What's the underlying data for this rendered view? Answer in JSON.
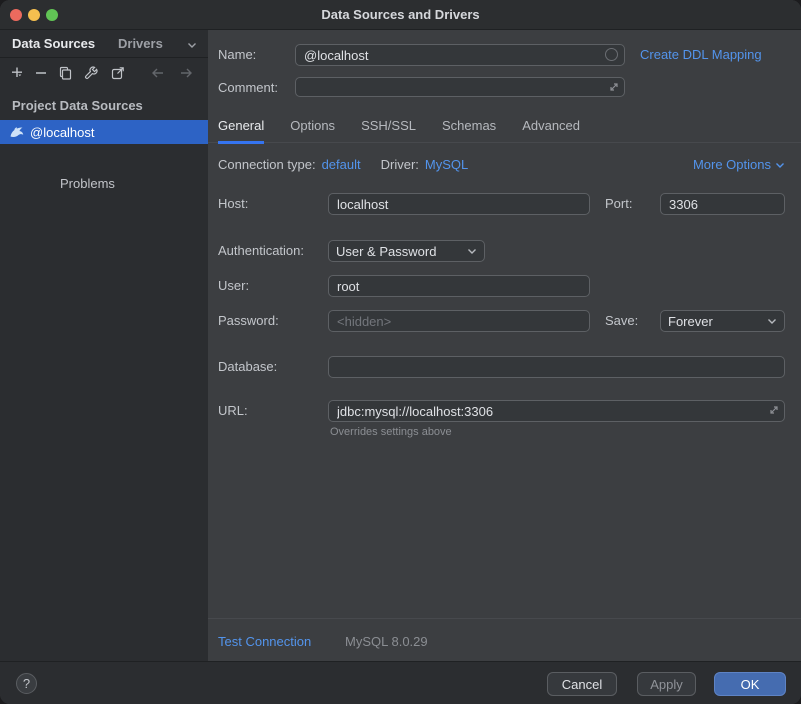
{
  "window": {
    "title": "Data Sources and Drivers"
  },
  "colors": {
    "accent": "#3574f0",
    "link": "#5394ec",
    "selection": "#2d63c5",
    "ok_button": "#456cb0"
  },
  "sidebar": {
    "tabs": [
      {
        "label": "Data Sources"
      },
      {
        "label": "Drivers"
      }
    ],
    "section_header": "Project Data Sources",
    "items": [
      {
        "label": "@localhost",
        "icon": "mysql-dolphin"
      }
    ],
    "problems_label": "Problems",
    "toolbar_icons": [
      "add",
      "remove",
      "duplicate",
      "wrench",
      "export",
      "back",
      "forward"
    ]
  },
  "form": {
    "name": {
      "label": "Name:",
      "value": "@localhost"
    },
    "ddl_link": "Create DDL Mapping",
    "comment": {
      "label": "Comment:",
      "value": ""
    },
    "tabs": [
      "General",
      "Options",
      "SSH/SSL",
      "Schemas",
      "Advanced"
    ],
    "active_tab": "General",
    "connection_type": {
      "label": "Connection type:",
      "value": "default"
    },
    "driver": {
      "label": "Driver:",
      "value": "MySQL"
    },
    "more_options": "More Options",
    "host": {
      "label": "Host:",
      "value": "localhost"
    },
    "port": {
      "label": "Port:",
      "value": "3306"
    },
    "authentication": {
      "label": "Authentication:",
      "value": "User & Password"
    },
    "user": {
      "label": "User:",
      "value": "root"
    },
    "password": {
      "label": "Password:",
      "placeholder": "<hidden>"
    },
    "save": {
      "label": "Save:",
      "value": "Forever"
    },
    "database": {
      "label": "Database:",
      "value": ""
    },
    "url": {
      "label": "URL:",
      "value": "jdbc:mysql://localhost:3306",
      "hint": "Overrides settings above"
    }
  },
  "footer": {
    "test_connection": "Test Connection",
    "driver_version": "MySQL 8.0.29",
    "cancel": "Cancel",
    "apply": "Apply",
    "ok": "OK",
    "help": "?"
  }
}
